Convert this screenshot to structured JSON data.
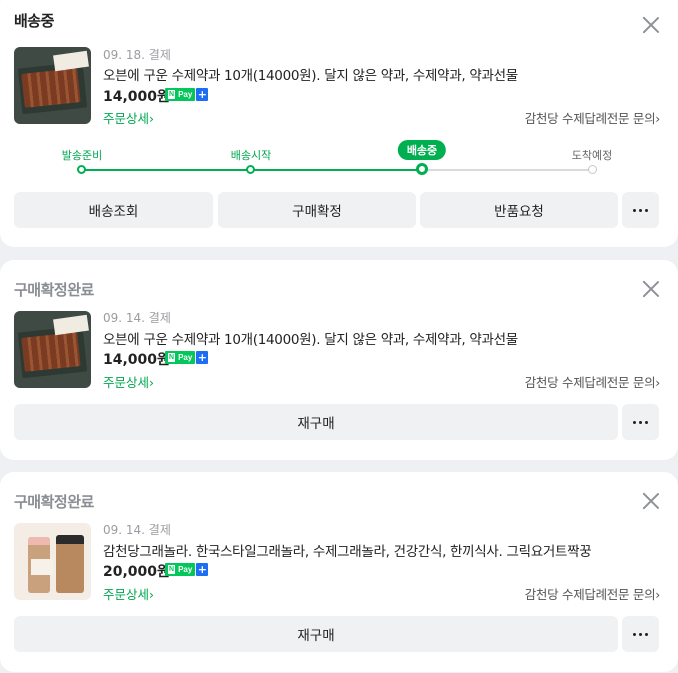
{
  "orders": [
    {
      "status": "배송중",
      "pay_date": "09. 18. 결제",
      "product_name": "오븐에 구운 수제약과 10개(14000원). 달지 않은 약과, 수제약과, 약과선물",
      "price": "14,000원",
      "npay_label": "Pay",
      "npay_n": "N",
      "npay_plus": "+",
      "detail_link": "주문상세",
      "seller_link": "감천당 수제답례전문 문의",
      "progress": {
        "steps": [
          "발송준비",
          "배송시작",
          "배송중",
          "도착예정"
        ],
        "current_index": 2
      },
      "buttons": [
        "배송조회",
        "구매확정",
        "반품요청"
      ]
    },
    {
      "status": "구매확정완료",
      "pay_date": "09. 14. 결제",
      "product_name": "오븐에 구운 수제약과 10개(14000원). 달지 않은 약과, 수제약과, 약과선물",
      "price": "14,000원",
      "npay_label": "Pay",
      "npay_n": "N",
      "npay_plus": "+",
      "detail_link": "주문상세",
      "seller_link": "감천당 수제답례전문 문의",
      "buttons": [
        "재구매"
      ]
    },
    {
      "status": "구매확정완료",
      "pay_date": "09. 14. 결제",
      "product_name": "감천당그래놀라. 한국스타일그래놀라, 수제그래놀라, 건강간식, 한끼식사. 그릭요거트짝꿍",
      "price": "20,000원",
      "npay_label": "Pay",
      "npay_n": "N",
      "npay_plus": "+",
      "detail_link": "주문상세",
      "seller_link": "감천당 수제답례전문 문의",
      "buttons": [
        "재구매"
      ]
    }
  ],
  "colors": {
    "accent_green": "#00b050",
    "npay_green": "#03c75a",
    "npay_blue": "#1e6ef5",
    "page_bg": "#eef0f3"
  },
  "icons": {
    "close": "close-icon",
    "more": "more-horizontal-icon",
    "chevron": "chevron-right-icon"
  }
}
